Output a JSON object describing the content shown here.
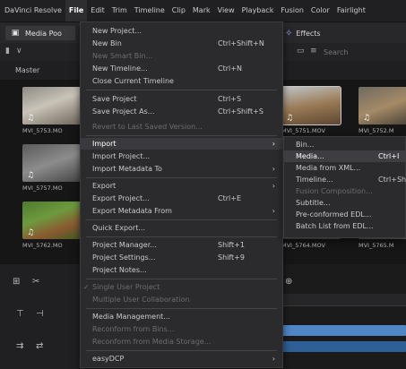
{
  "menubar": {
    "items": [
      "DaVinci Resolve",
      "File",
      "Edit",
      "Trim",
      "Timeline",
      "Clip",
      "Mark",
      "View",
      "Playback",
      "Fusion",
      "Color",
      "Fairlight"
    ],
    "active": "File"
  },
  "toolbar": {
    "media_pool_label": "Media Poo",
    "effects_label": "Effects"
  },
  "search": {
    "placeholder": "Search"
  },
  "pool": {
    "bin_label": "Master"
  },
  "clips": [
    {
      "name": "MVI_5753.MO"
    },
    {
      "name": "MVI_5751.MOV"
    },
    {
      "name": "MVI_5752.M"
    },
    {
      "name": "MVI_5757.MO"
    },
    {
      "name": "MVI_5762.MO"
    },
    {
      "name": "MVI_5764.MOV"
    },
    {
      "name": "MVI_5765.M"
    }
  ],
  "file_menu": {
    "new_project": "New Project...",
    "new_bin": "New Bin",
    "new_bin_sc": "Ctrl+Shift+N",
    "new_smart_bin": "New Smart Bin...",
    "new_timeline": "New Timeline...",
    "new_timeline_sc": "Ctrl+N",
    "close_timeline": "Close Current Timeline",
    "save_project": "Save Project",
    "save_project_sc": "Ctrl+S",
    "save_project_as": "Save Project As...",
    "save_project_as_sc": "Ctrl+Shift+S",
    "revert": "Revert to Last Saved Version...",
    "import": "Import",
    "import_project": "Import Project...",
    "import_metadata": "Import Metadata To",
    "export": "Export",
    "export_project": "Export Project...",
    "export_project_sc": "Ctrl+E",
    "export_metadata": "Export Metadata From",
    "quick_export": "Quick Export...",
    "project_manager": "Project Manager...",
    "project_manager_sc": "Shift+1",
    "project_settings": "Project Settings...",
    "project_settings_sc": "Shift+9",
    "project_notes": "Project Notes...",
    "single_user": "Single User Project",
    "multi_user": "Multiple User Collaboration",
    "media_management": "Media Management...",
    "reconform_bins": "Reconform from Bins...",
    "reconform_storage": "Reconform from Media Storage...",
    "easydcp": "easyDCP",
    "arrow": "›",
    "check": "✓"
  },
  "import_submenu": {
    "bin": "Bin...",
    "media": "Media...",
    "media_sc": "Ctrl+I",
    "media_xml": "Media from XML...",
    "timeline": "Timeline...",
    "timeline_sc": "Ctrl+Shi",
    "fusion_comp": "Fusion Composition...",
    "subtitle": "Subtitle...",
    "preconformed": "Pre-conformed EDL...",
    "batch_list": "Batch List from EDL..."
  },
  "colors": {
    "accent": "#4a7fd6",
    "track_blue": "#4f86c6",
    "menu_bg": "#2b2b2e"
  }
}
